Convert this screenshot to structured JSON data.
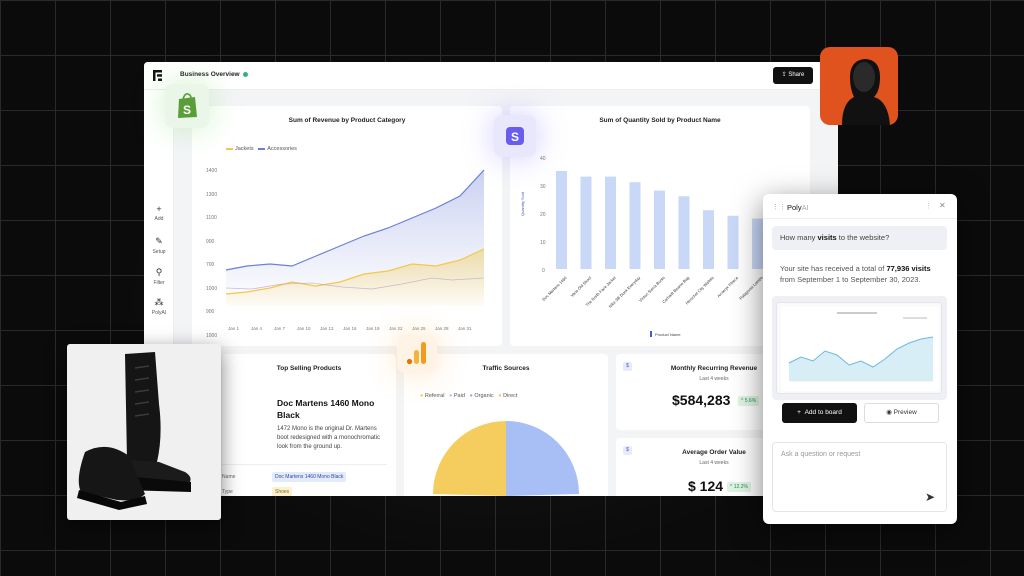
{
  "header": {
    "title": "Business Overview",
    "share_label": "Share"
  },
  "sidebar": {
    "items": [
      {
        "label": "Add",
        "icon": "plus-icon"
      },
      {
        "label": "Setup",
        "icon": "pencil-icon"
      },
      {
        "label": "Filter",
        "icon": "filter-icon"
      },
      {
        "label": "PolyAI",
        "icon": "sparkle-icon"
      }
    ]
  },
  "revenue": {
    "title": "Sum of Revenue by Product Category",
    "legend": [
      "Jackets",
      "Accessories"
    ],
    "yticks": [
      "1400",
      "1300",
      "1100",
      "900",
      "700",
      "1000",
      "900",
      "600"
    ],
    "xticks": [
      "Jan 1",
      "Jan 4",
      "Jan 7",
      "Jan 10",
      "Jan 13",
      "Jan 16",
      "Jan 19",
      "Jan 22",
      "Jan 25",
      "Jan 28",
      "Jan 31"
    ]
  },
  "quantity": {
    "title": "Sum of Quantity Sold by Product Name",
    "yticks": [
      "40",
      "30",
      "20",
      "10",
      "0"
    ],
    "ylabel": "Quantity Sold",
    "xlabel": "Product Name",
    "bars": [
      35,
      33,
      33,
      31,
      28,
      26,
      21,
      19,
      18,
      16
    ],
    "categories": [
      "Doc Martens 1460",
      "Vans Old Skool",
      "The North Face Jacket",
      "Nike SB Dunk Everyday",
      "Vinton Sierra Boots",
      "Carhartt Beanie Bag",
      "Herschel City Wallets",
      "Arcteryx Fleece",
      "Patagonia Lambs",
      "Sandal Tote"
    ]
  },
  "top_products": {
    "title": "Top Selling Products",
    "product_name": "Doc Martens 1460 Mono Black",
    "description": "1472 Mono is the original Dr. Martens boot redesigned with a monochromatic look from the ground up.",
    "field1_label": "uct Name",
    "field1_value": "Doc Martens 1460 Mono Black",
    "field2_label": "uct Type",
    "field2_value": "Shoes"
  },
  "traffic": {
    "title": "Traffic Sources",
    "legend": [
      "Referral",
      "Paid",
      "Organic",
      "Direct"
    ]
  },
  "mrr": {
    "title": "Monthly Recurring Revenue",
    "subtitle": "Last 4 weeks",
    "value": "$584,283",
    "change": "5.6%"
  },
  "aov": {
    "title": "Average Order Value",
    "subtitle": "Last 4 weeks",
    "value": "$ 124",
    "change": "12.2%"
  },
  "poly": {
    "title_a": "Poly",
    "title_b": "AI",
    "question_a": "How many ",
    "question_b": "visits",
    "question_c": " to the website?",
    "answer_a": "Your site has received a total of ",
    "answer_b": "77,936 visits",
    "answer_c": " from September 1 to September 30, 2023.",
    "add_label": "Add to board",
    "preview_label": "Preview",
    "input_placeholder": "Ask a question or request"
  },
  "colors": {
    "jackets": "#f2c94c",
    "accessories": "#6b7fd7",
    "bars": "#c9d8f7",
    "brand": "#111111"
  }
}
